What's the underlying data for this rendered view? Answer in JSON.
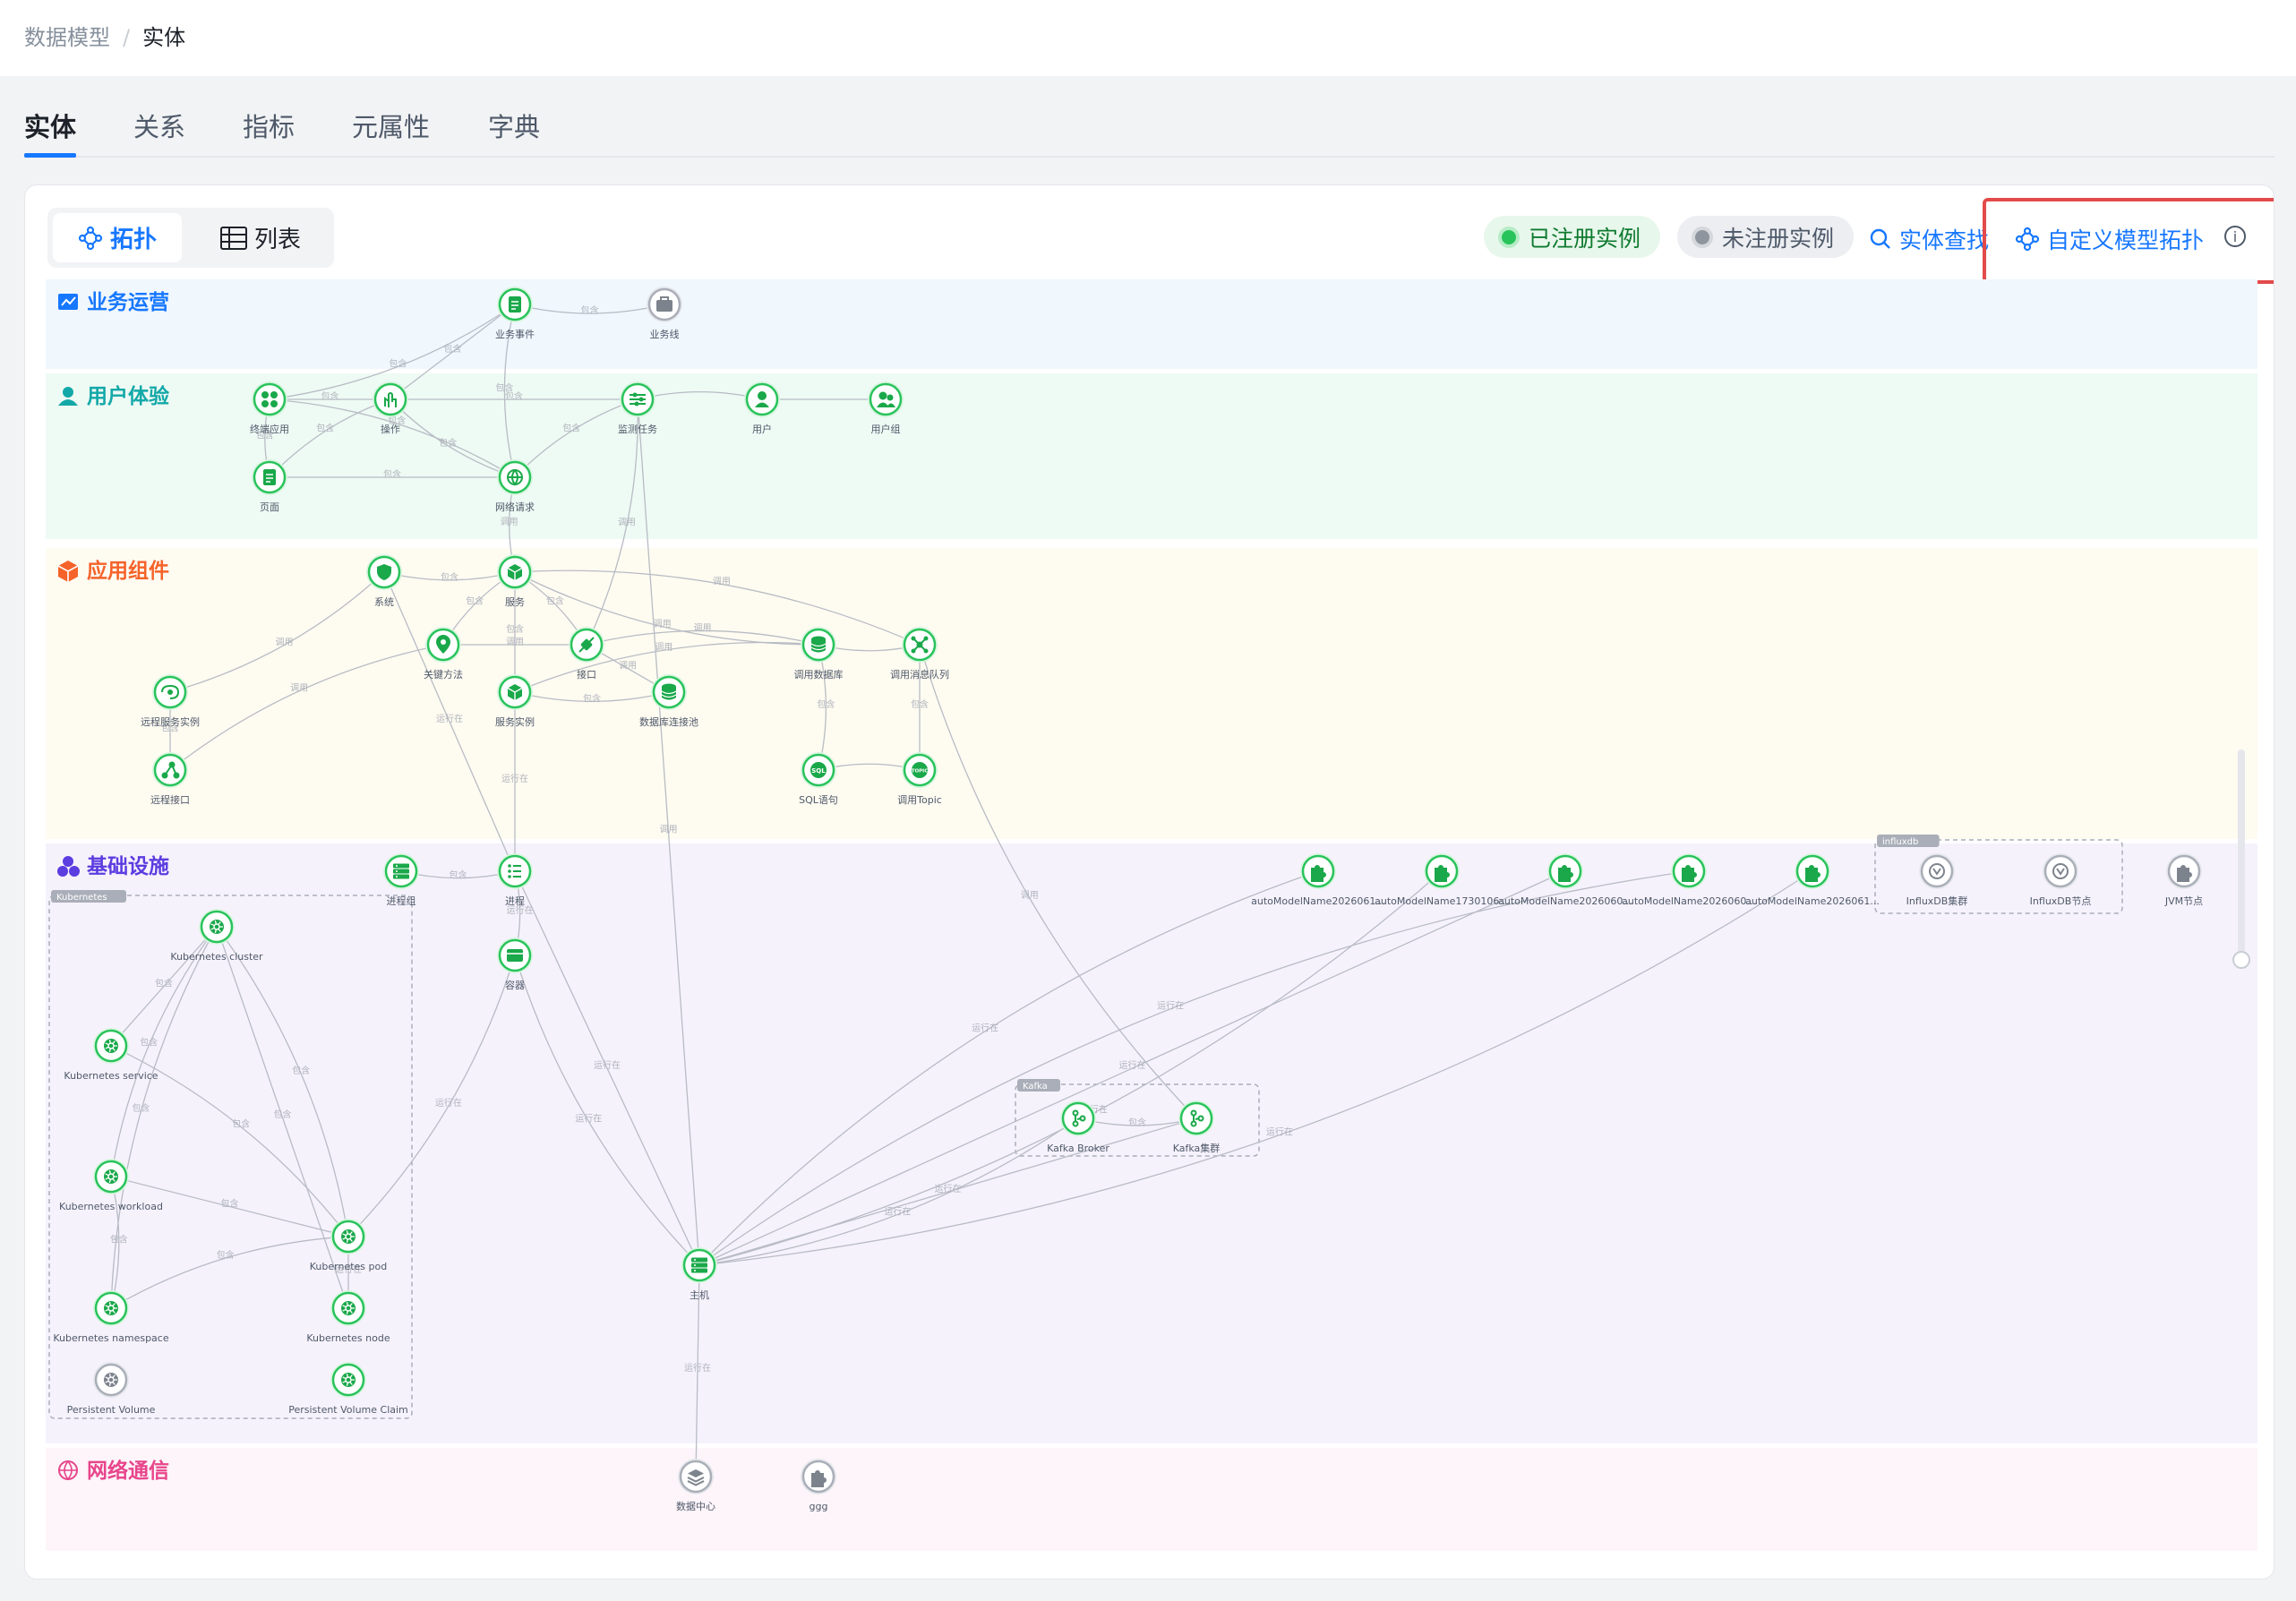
{
  "breadcrumb": {
    "root": "数据模型",
    "separator": "/",
    "current": "实体"
  },
  "tabs": [
    {
      "label": "实体"
    },
    {
      "label": "关系"
    },
    {
      "label": "指标"
    },
    {
      "label": "元属性"
    },
    {
      "label": "字典"
    }
  ],
  "toolbar": {
    "topology_label": "拓扑",
    "list_label": "列表",
    "registered_label": "已注册实例",
    "unregistered_label": "未注册实例",
    "search_label": "实体查找",
    "custom_label": "自定义模型拓扑",
    "info_glyph": "i"
  },
  "colors": {
    "accent": "#1677ff",
    "node_green": "#29c35b",
    "node_gray": "#8f959e",
    "highlight": "#e34a4a"
  },
  "layers": [
    {
      "name": "业务运营",
      "color": "#1677ff",
      "bg": "#f0f7fd",
      "icon": "line-chart-icon"
    },
    {
      "name": "用户体验",
      "color": "#13a8a8",
      "bg": "#eefaf4",
      "icon": "user-icon"
    },
    {
      "name": "应用组件",
      "color": "#f5632a",
      "bg": "#fefbf1",
      "icon": "cube-icon"
    },
    {
      "name": "基础设施",
      "color": "#5b3de0",
      "bg": "#f6f2fc",
      "icon": "cluster-icon"
    },
    {
      "name": "网络通信",
      "color": "#e8458b",
      "bg": "#fdf5fa",
      "icon": "globe-icon"
    }
  ],
  "groups": [
    {
      "name": "Kubernetes"
    },
    {
      "name": "Kafka"
    },
    {
      "name": "influxdb"
    }
  ],
  "nodes": [
    {
      "id": "biz_event",
      "label": "业务事件",
      "icon": "document-icon",
      "gray": false
    },
    {
      "id": "biz_line",
      "label": "业务线",
      "icon": "briefcase-icon",
      "gray": true
    },
    {
      "id": "app",
      "label": "终端应用",
      "icon": "apps-icon",
      "gray": false
    },
    {
      "id": "op",
      "label": "操作",
      "icon": "hand-icon",
      "gray": false
    },
    {
      "id": "monitor",
      "label": "监测任务",
      "icon": "sliders-icon",
      "gray": false
    },
    {
      "id": "user",
      "label": "用户",
      "icon": "user-icon",
      "gray": false
    },
    {
      "id": "usergroup",
      "label": "用户组",
      "icon": "users-icon",
      "gray": false
    },
    {
      "id": "page",
      "label": "页面",
      "icon": "document-icon",
      "gray": false
    },
    {
      "id": "netreq",
      "label": "网络请求",
      "icon": "globe-icon",
      "gray": false
    },
    {
      "id": "system",
      "label": "系统",
      "icon": "shield-icon",
      "gray": false
    },
    {
      "id": "service",
      "label": "服务",
      "icon": "cube-icon",
      "gray": false
    },
    {
      "id": "keymethod",
      "label": "关键方法",
      "icon": "pin-icon",
      "gray": false
    },
    {
      "id": "api",
      "label": "接口",
      "icon": "plug-icon",
      "gray": false
    },
    {
      "id": "calldb",
      "label": "调用数据库",
      "icon": "database-icon",
      "gray": false
    },
    {
      "id": "callmq",
      "label": "调用消息队列",
      "icon": "hub-icon",
      "gray": false
    },
    {
      "id": "remotesvc",
      "label": "远程服务实例",
      "icon": "link-icon",
      "gray": false
    },
    {
      "id": "svcinst",
      "label": "服务实例",
      "icon": "cube-icon",
      "gray": false
    },
    {
      "id": "dbpool",
      "label": "数据库连接池",
      "icon": "database-icon",
      "gray": false
    },
    {
      "id": "remoteapi",
      "label": "远程接口",
      "icon": "network-icon",
      "gray": false
    },
    {
      "id": "sql",
      "label": "SQL语句",
      "icon": "sql-icon",
      "gray": false
    },
    {
      "id": "topic",
      "label": "调用Topic",
      "icon": "topic-icon",
      "gray": false
    },
    {
      "id": "procgroup",
      "label": "进程组",
      "icon": "server-icon",
      "gray": false
    },
    {
      "id": "process",
      "label": "进程",
      "icon": "list-icon",
      "gray": false
    },
    {
      "id": "container",
      "label": "容器",
      "icon": "box-icon",
      "gray": false
    },
    {
      "id": "k8s_cluster",
      "label": "Kubernetes cluster",
      "icon": "helm-icon",
      "gray": false
    },
    {
      "id": "k8s_svc",
      "label": "Kubernetes service",
      "icon": "helm-icon",
      "gray": false
    },
    {
      "id": "k8s_wl",
      "label": "Kubernetes workload",
      "icon": "helm-icon",
      "gray": false
    },
    {
      "id": "k8s_pod",
      "label": "Kubernetes pod",
      "icon": "helm-icon",
      "gray": false
    },
    {
      "id": "k8s_ns",
      "label": "Kubernetes namespace",
      "icon": "helm-icon",
      "gray": false
    },
    {
      "id": "k8s_node",
      "label": "Kubernetes node",
      "icon": "helm-icon",
      "gray": false
    },
    {
      "id": "pv",
      "label": "Persistent Volume",
      "icon": "helm-icon",
      "gray": true
    },
    {
      "id": "pvc",
      "label": "Persistent Volume Claim",
      "icon": "helm-icon",
      "gray": false
    },
    {
      "id": "host",
      "label": "主机",
      "icon": "server-icon",
      "gray": false
    },
    {
      "id": "kbroker",
      "label": "Kafka Broker",
      "icon": "kafka-icon",
      "gray": false
    },
    {
      "id": "kcluster",
      "label": "Kafka集群",
      "icon": "kafka-icon",
      "gray": false
    },
    {
      "id": "am1",
      "label": "autoModelName2026061...",
      "icon": "puzzle-icon",
      "gray": false
    },
    {
      "id": "am2",
      "label": "autoModelName1730106...",
      "icon": "puzzle-icon",
      "gray": false
    },
    {
      "id": "am3",
      "label": "autoModelName2026060...",
      "icon": "puzzle-icon",
      "gray": false
    },
    {
      "id": "am4",
      "label": "autoModelName2026060...",
      "icon": "puzzle-icon",
      "gray": false
    },
    {
      "id": "am5",
      "label": "autoModelName2026061...",
      "icon": "puzzle-icon",
      "gray": false
    },
    {
      "id": "influx_c",
      "label": "InfluxDB集群",
      "icon": "influx-icon",
      "gray": true
    },
    {
      "id": "influx_n",
      "label": "InfluxDB节点",
      "icon": "influx-icon",
      "gray": true
    },
    {
      "id": "jvm",
      "label": "JVM节点",
      "icon": "puzzle-icon",
      "gray": true
    },
    {
      "id": "dc",
      "label": "数据中心",
      "icon": "layers-icon",
      "gray": true
    },
    {
      "id": "ggg",
      "label": "ggg",
      "icon": "puzzle-icon",
      "gray": true
    }
  ],
  "edges": [
    {
      "from": "biz_line",
      "to": "biz_event",
      "label": "包含"
    },
    {
      "from": "op",
      "to": "biz_event",
      "label": "包含"
    },
    {
      "from": "app",
      "to": "biz_event",
      "label": "包含"
    },
    {
      "from": "netreq",
      "to": "biz_event",
      "label": "包含"
    },
    {
      "from": "app",
      "to": "op",
      "label": "包含"
    },
    {
      "from": "app",
      "to": "page",
      "label": "包含"
    },
    {
      "from": "app",
      "to": "netreq",
      "label": "包含"
    },
    {
      "from": "op",
      "to": "monitor",
      "label": "包含"
    },
    {
      "from": "op",
      "to": "netreq",
      "label": "包含"
    },
    {
      "from": "page",
      "to": "op",
      "label": "包含"
    },
    {
      "from": "page",
      "to": "netreq",
      "label": "包含"
    },
    {
      "from": "monitor",
      "to": "netreq",
      "label": "包含"
    },
    {
      "from": "monitor",
      "to": "user",
      "label": ""
    },
    {
      "from": "user",
      "to": "usergroup",
      "label": ""
    },
    {
      "from": "netreq",
      "to": "service",
      "label": "调用"
    },
    {
      "from": "monitor",
      "to": "api",
      "label": "调用"
    },
    {
      "from": "monitor",
      "to": "host",
      "label": "调用"
    },
    {
      "from": "system",
      "to": "service",
      "label": "包含"
    },
    {
      "from": "system",
      "to": "remotesvc",
      "label": "调用"
    },
    {
      "from": "system",
      "to": "process",
      "label": "运行在"
    },
    {
      "from": "service",
      "to": "keymethod",
      "label": "包含"
    },
    {
      "from": "service",
      "to": "api",
      "label": "包含"
    },
    {
      "from": "service",
      "to": "svcinst",
      "label": "包含"
    },
    {
      "from": "service",
      "to": "calldb",
      "label": "调用"
    },
    {
      "from": "service",
      "to": "callmq",
      "label": "调用"
    },
    {
      "from": "keymethod",
      "to": "api",
      "label": "调用"
    },
    {
      "from": "keymethod",
      "to": "remoteapi",
      "label": "调用"
    },
    {
      "from": "api",
      "to": "calldb",
      "label": "调用"
    },
    {
      "from": "api",
      "to": "dbpool",
      "label": "调用"
    },
    {
      "from": "svcinst",
      "to": "dbpool",
      "label": "包含"
    },
    {
      "from": "svcinst",
      "to": "calldb",
      "label": "调用"
    },
    {
      "from": "svcinst",
      "to": "process",
      "label": "运行在"
    },
    {
      "from": "calldb",
      "to": "callmq",
      "label": ""
    },
    {
      "from": "calldb",
      "to": "sql",
      "label": "包含"
    },
    {
      "from": "callmq",
      "to": "topic",
      "label": "包含"
    },
    {
      "from": "callmq",
      "to": "kcluster",
      "label": "调用"
    },
    {
      "from": "sql",
      "to": "topic",
      "label": ""
    },
    {
      "from": "remotesvc",
      "to": "remoteapi",
      "label": "包含"
    },
    {
      "from": "procgroup",
      "to": "process",
      "label": "包含"
    },
    {
      "from": "process",
      "to": "container",
      "label": "运行在"
    },
    {
      "from": "process",
      "to": "host",
      "label": "运行在"
    },
    {
      "from": "container",
      "to": "host",
      "label": "运行在"
    },
    {
      "from": "container",
      "to": "k8s_pod",
      "label": "运行在"
    },
    {
      "from": "k8s_cluster",
      "to": "k8s_svc",
      "label": "包含"
    },
    {
      "from": "k8s_cluster",
      "to": "k8s_wl",
      "label": "包含"
    },
    {
      "from": "k8s_cluster",
      "to": "k8s_pod",
      "label": "包含"
    },
    {
      "from": "k8s_cluster",
      "to": "k8s_node",
      "label": "包含"
    },
    {
      "from": "k8s_cluster",
      "to": "k8s_ns",
      "label": "包含"
    },
    {
      "from": "k8s_svc",
      "to": "k8s_pod",
      "label": "包含"
    },
    {
      "from": "k8s_wl",
      "to": "k8s_pod",
      "label": "包含"
    },
    {
      "from": "k8s_ns",
      "to": "k8s_wl",
      "label": "包含"
    },
    {
      "from": "k8s_ns",
      "to": "k8s_pod",
      "label": "包含"
    },
    {
      "from": "k8s_node",
      "to": "k8s_pod",
      "label": "运行在"
    },
    {
      "from": "kbroker",
      "to": "kcluster",
      "label": "包含"
    },
    {
      "from": "kbroker",
      "to": "host",
      "label": "运行在"
    },
    {
      "from": "kcluster",
      "to": "host",
      "label": "运行在"
    },
    {
      "from": "am1",
      "to": "host",
      "label": "运行在"
    },
    {
      "from": "am2",
      "to": "host",
      "label": "运行在"
    },
    {
      "from": "am3",
      "to": "host",
      "label": "运行在"
    },
    {
      "from": "am4",
      "to": "host",
      "label": "运行在"
    },
    {
      "from": "am5",
      "to": "host",
      "label": "运行在"
    },
    {
      "from": "host",
      "to": "dc",
      "label": "运行在"
    }
  ]
}
